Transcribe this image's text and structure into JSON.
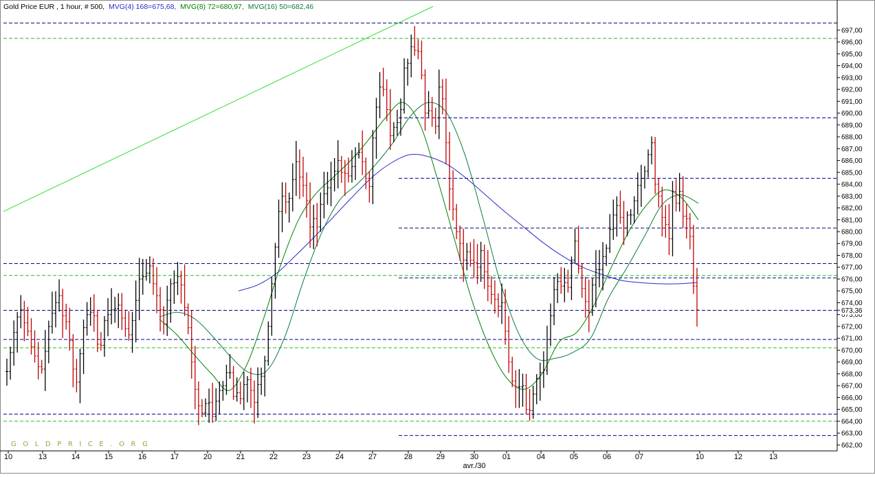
{
  "header": {
    "title": "Gold Price EUR , 1 hour, # 500,",
    "mvg4": "MVG(4) 168=675,68,",
    "mvg8": "MVG(8) 72=680,97,",
    "mvg16": "MVG(16) 50=682,46"
  },
  "watermark": "G O L D P R I C E . O R G",
  "colors": {
    "up": "#000000",
    "down": "#c00000",
    "mvg4": "#2a2acc",
    "mvg8": "#008000",
    "mvg16": "#0a7a3a",
    "trend": "#33dd33",
    "blue_level": "#00008b",
    "green_level": "#22bb22",
    "last_price": "#4444cc"
  },
  "chart_data": {
    "type": "line",
    "title": "Gold Price EUR , 1 hour, # 500,",
    "xlabel": "avr./30",
    "ylabel": "",
    "ylim": [
      661.5,
      698.5
    ],
    "y_ticks": [
      "662,00",
      "663,00",
      "664,00",
      "665,00",
      "666,00",
      "667,00",
      "668,00",
      "669,00",
      "670,00",
      "671,00",
      "672,00",
      "673,00",
      "674,00",
      "675,00",
      "676,00",
      "677,00",
      "678,00",
      "679,00",
      "680,00",
      "681,00",
      "682,00",
      "683,00",
      "684,00",
      "685,00",
      "686,00",
      "687,00",
      "688,00",
      "689,00",
      "690,00",
      "691,00",
      "692,00",
      "693,00",
      "694,00",
      "695,00",
      "696,00",
      "697,00"
    ],
    "x_ticks": [
      "10",
      "13",
      "14",
      "15",
      "16",
      "17",
      "20",
      "21",
      "22",
      "23",
      "24",
      "27",
      "28",
      "29",
      "30",
      "01",
      "04",
      "05",
      "06",
      "07",
      "10",
      "12",
      "13"
    ],
    "last_price_label": "673,36",
    "last_price": 673.36,
    "series": [
      {
        "name": "Gold Price EUR",
        "values": [
          668.2,
          669.8,
          671.5,
          672.8,
          673.4,
          672.3,
          671.6,
          670.3,
          669.5,
          668.6,
          668.4,
          669.9,
          672.0,
          673.1,
          674.0,
          674.6,
          672.9,
          672.4,
          670.8,
          668.4,
          667.3,
          669.7,
          671.9,
          673.0,
          673.2,
          672.9,
          670.5,
          670.4,
          672.5,
          673.0,
          673.4,
          673.5,
          673.8,
          672.7,
          671.8,
          671.3,
          672.5,
          674.2,
          676.0,
          676.2,
          676.5,
          677.1,
          675.6,
          674.6,
          673.4,
          672.2,
          674.2,
          675.6,
          675.7,
          676.2,
          675.5,
          673.6,
          671.9,
          669.0,
          666.7,
          665.3,
          664.7,
          665.5,
          665.6,
          664.4,
          665.7,
          666.6,
          667.0,
          668.1,
          668.1,
          666.1,
          666.4,
          665.9,
          667.1,
          667.5,
          666.6,
          665.6,
          667.1,
          667.8,
          669.1,
          672.0,
          675.6,
          678.7,
          681.7,
          683.0,
          682.5,
          682.8,
          684.4,
          685.9,
          684.6,
          683.9,
          682.6,
          680.4,
          681.1,
          680.4,
          682.3,
          683.2,
          683.7,
          684.4,
          685.1,
          686.0,
          685.0,
          684.9,
          684.7,
          685.5,
          686.5,
          686.7,
          685.9,
          684.5,
          683.8,
          687.9,
          690.5,
          692.2,
          692.0,
          690.3,
          688.1,
          688.8,
          689.2,
          690.3,
          693.8,
          694.2,
          695.6,
          695.3,
          695.2,
          693.2,
          690.0,
          690.2,
          689.6,
          688.9,
          692.2,
          691.2,
          687.5,
          683.6,
          681.9,
          680.0,
          679.0,
          677.6,
          678.3,
          677.6,
          677.4,
          677.0,
          678.4,
          676.6,
          675.4,
          674.7,
          674.3,
          673.7,
          674.0,
          671.6,
          669.0,
          667.4,
          666.9,
          666.9,
          667.0,
          665.0,
          664.9,
          666.3,
          667.6,
          668.1,
          668.3,
          670.9,
          672.9,
          675.1,
          675.8,
          675.4,
          675.7,
          675.3,
          677.6,
          679.2,
          676.9,
          675.2,
          674.1,
          673.2,
          675.5,
          676.8,
          676.8,
          677.9,
          678.6,
          680.2,
          681.4,
          682.2,
          681.2,
          680.3,
          681.4,
          681.4,
          682.6,
          683.9,
          684.5,
          685.1,
          686.5,
          687.5,
          684.0,
          683.0,
          681.2,
          680.6,
          679.4,
          683.4,
          682.4,
          683.4,
          681.3,
          681.1,
          679.6,
          675.4,
          673.4
        ]
      },
      {
        "name": "MVG(4)",
        "values": [
          675.0,
          675.5,
          676.5,
          678.0,
          679.6,
          681.3,
          683.0,
          684.6,
          685.8,
          686.5,
          686.3,
          685.6,
          684.4,
          683.0,
          681.6,
          680.3,
          679.0,
          677.9,
          677.0,
          676.4,
          675.9,
          675.7,
          675.6,
          675.6,
          675.7
        ]
      },
      {
        "name": "MVG(8)",
        "values": [
          672.6,
          671.3,
          669.6,
          668.0,
          666.6,
          668.7,
          672.7,
          677.3,
          681.0,
          683.2,
          684.6,
          686.0,
          687.7,
          689.6,
          690.9,
          689.0,
          684.4,
          679.2,
          674.1,
          670.2,
          667.6,
          666.7,
          668.0,
          670.7,
          671.5,
          673.8,
          677.0,
          680.0,
          682.2,
          683.5,
          682.9,
          681.0
        ]
      },
      {
        "name": "MVG(16)",
        "values": [
          672.8,
          673.2,
          672.6,
          671.1,
          669.4,
          668.1,
          668.3,
          671.2,
          675.8,
          679.8,
          682.6,
          684.0,
          685.6,
          687.5,
          689.8,
          690.9,
          690.0,
          686.5,
          681.2,
          675.6,
          671.4,
          669.3,
          669.3,
          669.8,
          671.0,
          674.4,
          676.9,
          679.6,
          682.3,
          683.1,
          682.4
        ]
      }
    ],
    "levels": [
      {
        "value": 697.6,
        "color": "blue",
        "full_width": true
      },
      {
        "value": 696.3,
        "color": "green",
        "full_width": true
      },
      {
        "value": 689.6,
        "color": "blue",
        "full_width": false
      },
      {
        "value": 684.5,
        "color": "blue",
        "full_width": false
      },
      {
        "value": 680.3,
        "color": "blue",
        "full_width": false
      },
      {
        "value": 677.3,
        "color": "blue",
        "full_width": true
      },
      {
        "value": 676.3,
        "color": "green",
        "full_width": true
      },
      {
        "value": 676.1,
        "color": "blue",
        "full_width": false
      },
      {
        "value": 673.36,
        "color": "blue",
        "full_width": true
      },
      {
        "value": 670.9,
        "color": "blue",
        "full_width": true
      },
      {
        "value": 670.2,
        "color": "green",
        "full_width": true
      },
      {
        "value": 664.6,
        "color": "blue",
        "full_width": true
      },
      {
        "value": 664.0,
        "color": "green",
        "full_width": true
      },
      {
        "value": 662.8,
        "color": "blue",
        "full_width": false
      }
    ],
    "trendline": {
      "from": 681.7,
      "to": 699.0
    },
    "grid": false,
    "legend": "top-left"
  }
}
